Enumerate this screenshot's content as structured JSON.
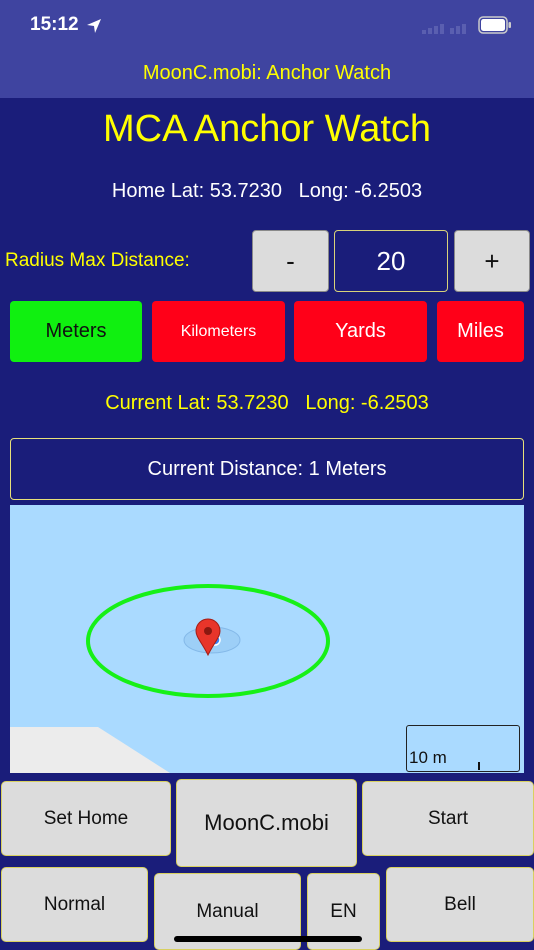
{
  "status": {
    "time": "15:12"
  },
  "nav": {
    "title": "MoonC.mobi: Anchor Watch"
  },
  "app": {
    "title": "MCA Anchor Watch",
    "home_line": "Home Lat: 53.7230   Long: -6.2503"
  },
  "radius": {
    "label": "Radius Max Distance:",
    "minus": "-",
    "value": "20",
    "plus": "+"
  },
  "units": {
    "meters": "Meters",
    "kilometers": "Kilometers",
    "yards": "Yards",
    "miles": "Miles",
    "selected_color": "#10f010",
    "unselected_color": "#ff0018"
  },
  "current_line": "Current Lat: 53.7230   Long: -6.2503",
  "distance_text": "Current Distance: 1 Meters",
  "map": {
    "scale_label": "10 m",
    "water_color": "#aadaff",
    "circle_color": "#17f017"
  },
  "buttons": {
    "set_home": "Set Home",
    "moonc": "MoonC.mobi",
    "start": "Start",
    "normal": "Normal",
    "manual": "Manual",
    "lang": "EN",
    "bell": "Bell"
  }
}
